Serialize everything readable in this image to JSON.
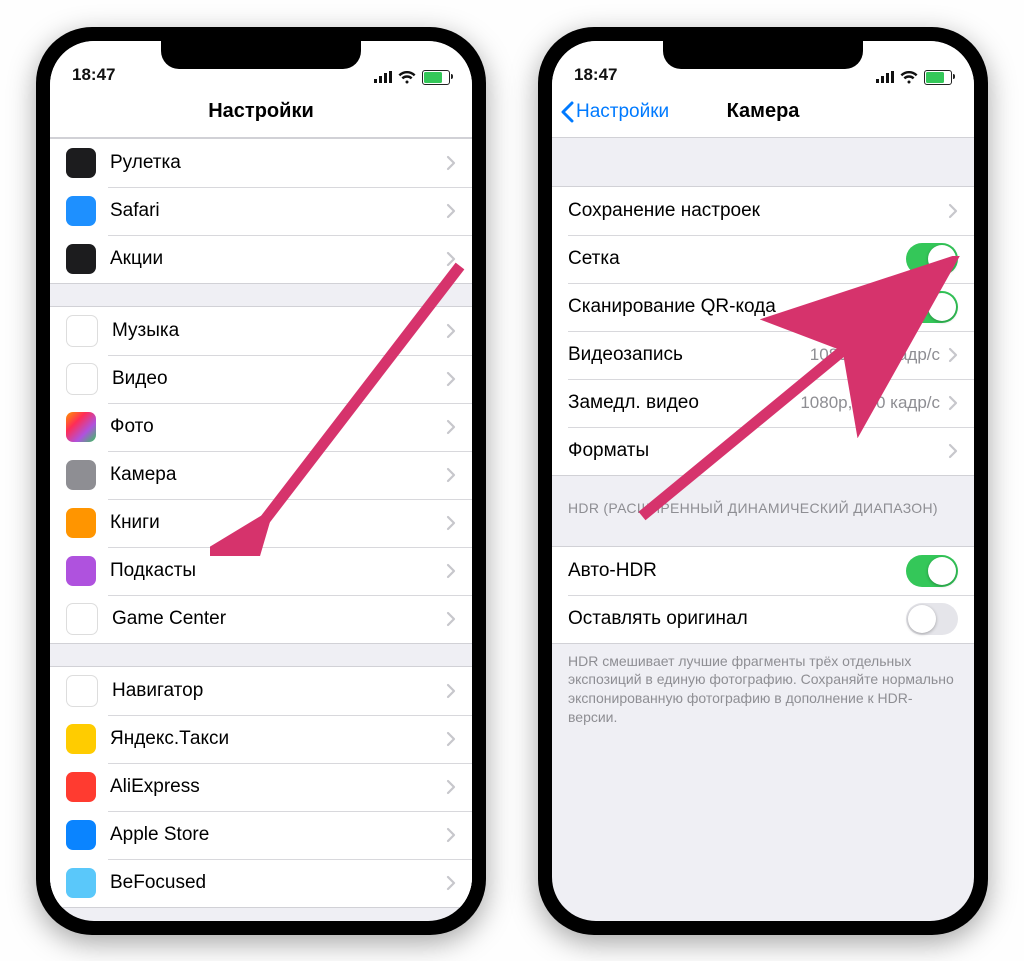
{
  "status_time": "18:47",
  "left": {
    "title": "Настройки",
    "groups": [
      {
        "rows": [
          {
            "icon": "ic-ruler",
            "label": "Рулетка"
          },
          {
            "icon": "ic-safari",
            "label": "Safari"
          },
          {
            "icon": "ic-stocks",
            "label": "Акции"
          }
        ]
      },
      {
        "rows": [
          {
            "icon": "ic-music",
            "label": "Музыка"
          },
          {
            "icon": "ic-video",
            "label": "Видео"
          },
          {
            "icon": "ic-photos",
            "label": "Фото"
          },
          {
            "icon": "ic-camera",
            "label": "Камера"
          },
          {
            "icon": "ic-books",
            "label": "Книги"
          },
          {
            "icon": "ic-podcasts",
            "label": "Подкасты"
          },
          {
            "icon": "ic-gamecenter",
            "label": "Game Center"
          }
        ]
      },
      {
        "rows": [
          {
            "icon": "ic-navigator",
            "label": "Навигатор"
          },
          {
            "icon": "ic-yandextaxi",
            "label": "Яндекс.Такси"
          },
          {
            "icon": "ic-aliexpress",
            "label": "AliExpress"
          },
          {
            "icon": "ic-applestore",
            "label": "Apple Store"
          },
          {
            "icon": "ic-befocused",
            "label": "BeFocused"
          }
        ]
      }
    ]
  },
  "right": {
    "back_label": "Настройки",
    "title": "Камера",
    "group1": [
      {
        "label": "Сохранение настроек",
        "type": "nav"
      },
      {
        "label": "Сетка",
        "type": "toggle",
        "on": true
      },
      {
        "label": "Сканирование QR-кода",
        "type": "toggle",
        "on": true
      },
      {
        "label": "Видеозапись",
        "type": "value",
        "value": "1080p, 30 кадр/с"
      },
      {
        "label": "Замедл. видео",
        "type": "value",
        "value": "1080p, 240 кадр/с"
      },
      {
        "label": "Форматы",
        "type": "nav"
      }
    ],
    "hdr_header": "HDR (РАСШИРЕННЫЙ ДИНАМИЧЕСКИЙ ДИАПАЗОН)",
    "group2": [
      {
        "label": "Авто-HDR",
        "type": "toggle",
        "on": true
      },
      {
        "label": "Оставлять оригинал",
        "type": "toggle",
        "on": false
      }
    ],
    "hdr_footer": "HDR смешивает лучшие фрагменты трёх отдельных экспозиций в единую фотографию. Сохраняйте нормально экспонированную фотографию в дополнение к HDR-версии."
  }
}
